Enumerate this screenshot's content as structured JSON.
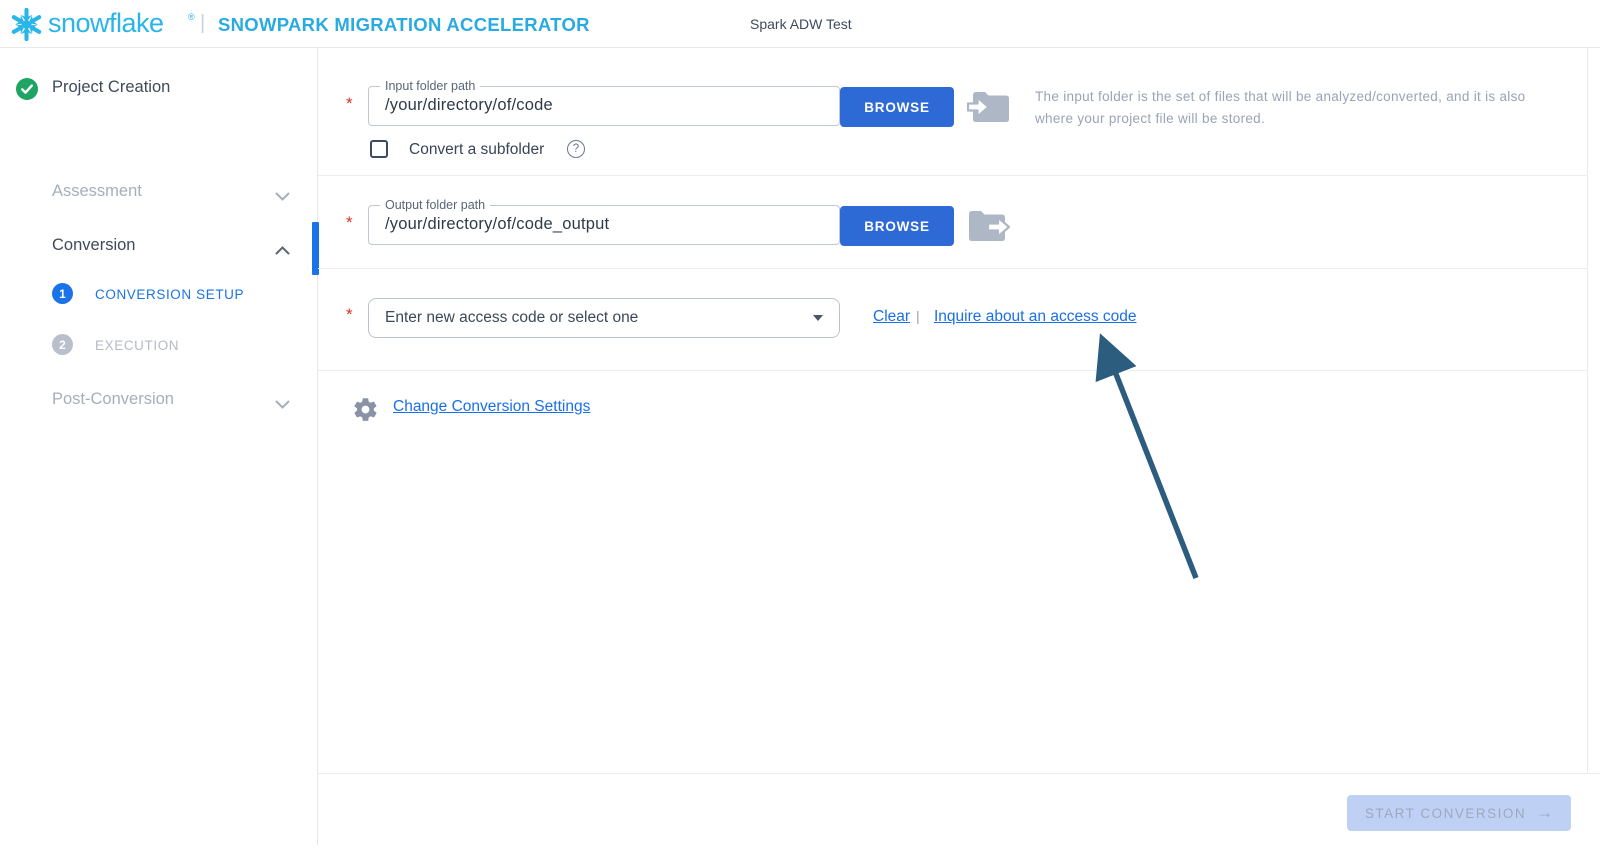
{
  "header": {
    "brand": "snowflake",
    "registered": "®",
    "divider": "|",
    "app_title": "SNOWPARK MIGRATION ACCELERATOR",
    "project_name": "Spark ADW Test"
  },
  "sidebar": {
    "items": [
      {
        "label": "Project Creation",
        "state": "complete"
      },
      {
        "label": "Assessment",
        "state": "collapsed-disabled"
      },
      {
        "label": "Conversion",
        "state": "expanded"
      },
      {
        "label": "CONVERSION SETUP",
        "number": "1",
        "state": "active"
      },
      {
        "label": "EXECUTION",
        "number": "2",
        "state": "disabled"
      },
      {
        "label": "Post-Conversion",
        "state": "collapsed-disabled"
      }
    ]
  },
  "main": {
    "required_marker": "*",
    "input_folder": {
      "label": "Input folder path",
      "value": "/your/directory/of/code",
      "browse": "BROWSE",
      "checkbox_label": "Convert a subfolder",
      "help_symbol": "?",
      "help_text": "The input folder is the set of files that will be analyzed/converted, and it is also where your project file will be stored.",
      "checkbox_checked": false
    },
    "output_folder": {
      "label": "Output folder path",
      "value": "/your/directory/of/code_output",
      "browse": "BROWSE"
    },
    "access_code": {
      "placeholder": "Enter new access code or select one",
      "clear": "Clear",
      "separator": "|",
      "inquire": "Inquire about an access code"
    },
    "settings": {
      "link": "Change Conversion Settings"
    },
    "footer": {
      "start_button": "START CONVERSION",
      "arrow": "→"
    }
  },
  "colors": {
    "brand_blue": "#29b5e8",
    "primary_blue": "#1a73e8",
    "browse_button_blue": "#2e6ad5",
    "success_green": "#1fa463",
    "required_red": "#d93025",
    "disabled_sidebar_text": "#a7aebb",
    "help_text_gray": "#9aa3b5",
    "folder_icon_gray": "#aeb7c6",
    "annotation_arrow": "#2c5d7f",
    "disabled_button_bg": "#bed1f4",
    "disabled_button_text": "#9aa8c2"
  },
  "icons": [
    "snowflake-logo-icon",
    "check-circle-icon",
    "chevron-down-icon",
    "chevron-up-icon",
    "folder-arrow-in-icon",
    "folder-arrow-out-icon",
    "question-circle-icon",
    "caret-down-icon",
    "gear-icon",
    "arrow-right-icon",
    "annotation-arrow-icon"
  ]
}
